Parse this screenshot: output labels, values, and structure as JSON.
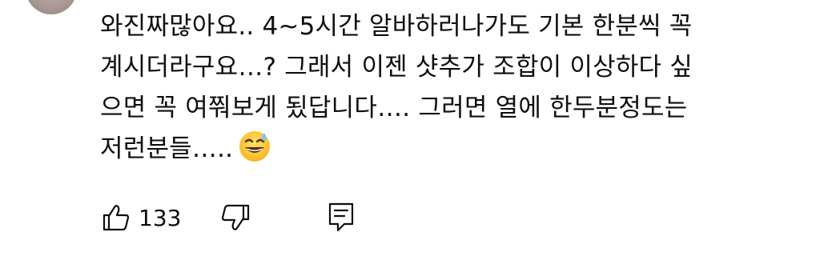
{
  "comment": {
    "lines": [
      "와진짜많아요.. 4~5시간 알바하러나가도 기본 한분씩 꼭",
      "계시더라구요…? 그래서 이젠 샷추가 조합이 이상하다 싶",
      "으면 꼭 여쭤보게 됬답니다…. 그러면 열에 한두분정도는",
      "저런분들….."
    ],
    "emoji": "grinning-face-with-sweat"
  },
  "actions": {
    "like_count": "133",
    "like_icon": "thumbs-up-icon",
    "dislike_icon": "thumbs-down-icon",
    "reply_icon": "comment-reply-icon"
  }
}
